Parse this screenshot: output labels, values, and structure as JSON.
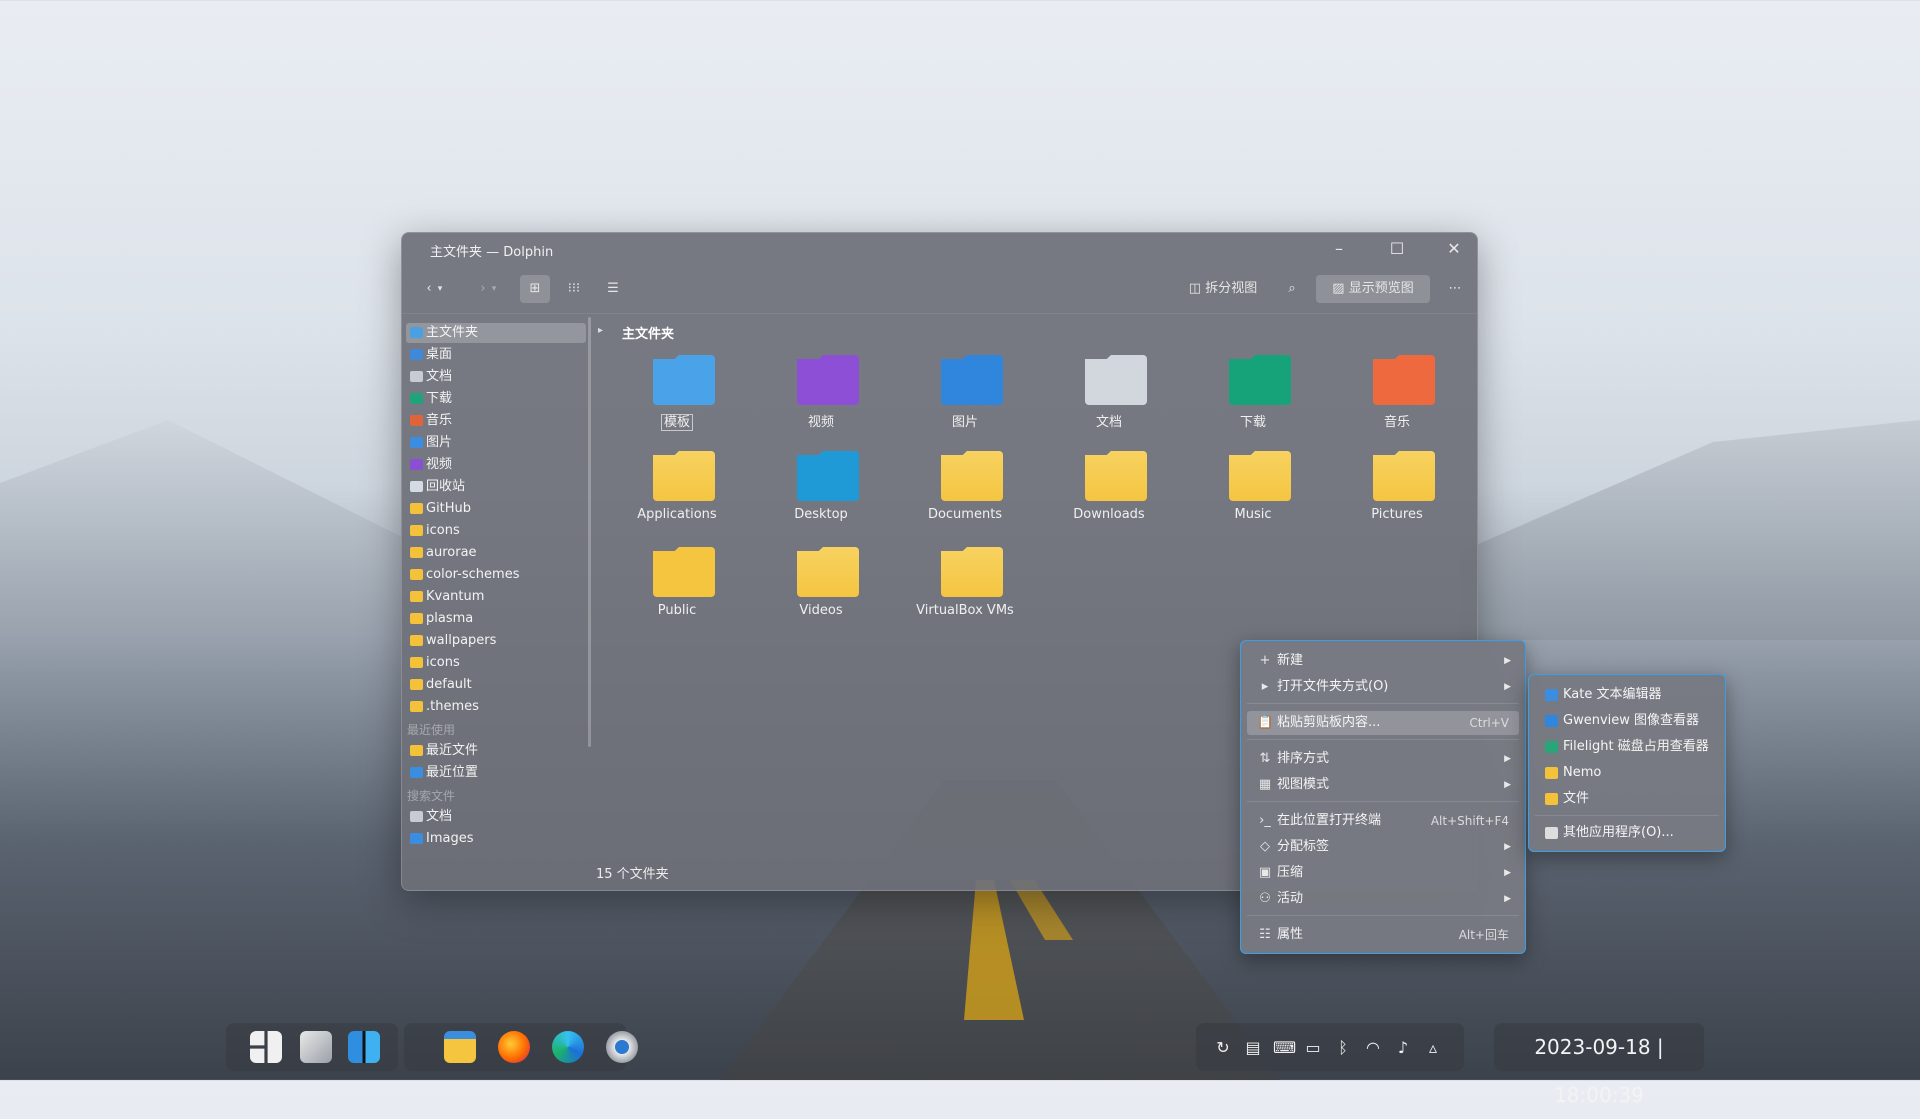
{
  "window": {
    "title": "主文件夹 — Dolphin",
    "toolbar": {
      "split_view_label": "拆分视图",
      "preview_label": "显示预览图"
    },
    "breadcrumb": "主文件夹",
    "status": "15 个文件夹"
  },
  "sidebar": {
    "places": [
      {
        "label": "主文件夹",
        "color": "#4aa0e0",
        "selected": true
      },
      {
        "label": "桌面",
        "color": "#3e8ad8"
      },
      {
        "label": "文档",
        "color": "#c8ccd2"
      },
      {
        "label": "下载",
        "color": "#1fa37a"
      },
      {
        "label": "音乐",
        "color": "#e0643a"
      },
      {
        "label": "图片",
        "color": "#3b8ddf"
      },
      {
        "label": "视频",
        "color": "#8a4fd3"
      },
      {
        "label": "回收站",
        "color": "#d5dbe3"
      },
      {
        "label": "GitHub",
        "color": "#f3c13a"
      },
      {
        "label": "icons",
        "color": "#f3c13a"
      },
      {
        "label": "aurorae",
        "color": "#f3c13a"
      },
      {
        "label": "color-schemes",
        "color": "#f3c13a"
      },
      {
        "label": "Kvantum",
        "color": "#f3c13a"
      },
      {
        "label": "plasma",
        "color": "#f3c13a"
      },
      {
        "label": "wallpapers",
        "color": "#f3c13a"
      },
      {
        "label": "icons",
        "color": "#f3c13a"
      },
      {
        "label": "default",
        "color": "#f3c13a"
      },
      {
        "label": ".themes",
        "color": "#f3c13a"
      }
    ],
    "recent_heading": "最近使用",
    "recent": [
      {
        "label": "最近文件",
        "color": "#f3c13a"
      },
      {
        "label": "最近位置",
        "color": "#3b8ddf"
      }
    ],
    "search_heading": "搜索文件",
    "search": [
      {
        "label": "文档",
        "color": "#c8ccd2"
      },
      {
        "label": "Images",
        "color": "#3b8ddf"
      }
    ]
  },
  "files": [
    {
      "label": "模板",
      "icon": "templates-folder-icon",
      "color": "#4aa3e8"
    },
    {
      "label": "视频",
      "icon": "videos-folder-icon",
      "color": "#8c4fd6"
    },
    {
      "label": "图片",
      "icon": "pictures-folder-icon",
      "color": "#2f86dc"
    },
    {
      "label": "文档",
      "icon": "documents-folder-icon",
      "color": "#d2d7de"
    },
    {
      "label": "下载",
      "icon": "downloads-folder-icon",
      "color": "#17a37a"
    },
    {
      "label": "音乐",
      "icon": "music-folder-icon",
      "color": "#ee6a3e"
    },
    {
      "label": "Applications",
      "icon": "folder-icon",
      "color": "#f5c540"
    },
    {
      "label": "Desktop",
      "icon": "desktop-folder-icon",
      "color": "#1f9ad6"
    },
    {
      "label": "Documents",
      "icon": "folder-icon",
      "color": "#f5c540"
    },
    {
      "label": "Downloads",
      "icon": "folder-icon",
      "color": "#f5c540"
    },
    {
      "label": "Music",
      "icon": "folder-icon",
      "color": "#f5c540"
    },
    {
      "label": "Pictures",
      "icon": "folder-icon",
      "color": "#f5c540"
    },
    {
      "label": "Public",
      "icon": "public-folder-icon",
      "color": "#f5c540"
    },
    {
      "label": "Videos",
      "icon": "folder-icon",
      "color": "#f5c540"
    },
    {
      "label": "VirtualBox VMs",
      "icon": "folder-icon",
      "color": "#f5c540"
    }
  ],
  "context_menu": {
    "items": [
      {
        "label": "新建",
        "icon": "+",
        "submenu": true
      },
      {
        "label": "打开文件夹方式(O)",
        "icon": "▸",
        "submenu": true
      },
      {
        "label": "粘贴剪贴板内容...",
        "icon": "📋",
        "shortcut": "Ctrl+V",
        "highlighted": true
      },
      {
        "label": "排序方式",
        "icon": "⇅",
        "submenu": true
      },
      {
        "label": "视图模式",
        "icon": "▦",
        "submenu": true
      },
      {
        "label": "在此位置打开终端",
        "icon": "›_",
        "shortcut": "Alt+Shift+F4"
      },
      {
        "label": "分配标签",
        "icon": "◇",
        "submenu": true
      },
      {
        "label": "压缩",
        "icon": "▣",
        "submenu": true
      },
      {
        "label": "活动",
        "icon": "⚇",
        "submenu": true
      },
      {
        "label": "属性",
        "icon": "☷",
        "shortcut": "Alt+回车"
      }
    ]
  },
  "open_with_submenu": {
    "items": [
      {
        "label": "Kate 文本编辑器",
        "color": "#3b8ddf"
      },
      {
        "label": "Gwenview 图像查看器",
        "color": "#2f86dc"
      },
      {
        "label": "Filelight 磁盘占用查看器",
        "color": "#2aa57a"
      },
      {
        "label": "Nemo",
        "color": "#f3c13a"
      },
      {
        "label": "文件",
        "color": "#f3c13a"
      },
      {
        "label": "其他应用程序(O)...",
        "color": "#dddddd"
      }
    ]
  },
  "taskbar": {
    "clock": "2023-09-18 | 18:00:39"
  }
}
